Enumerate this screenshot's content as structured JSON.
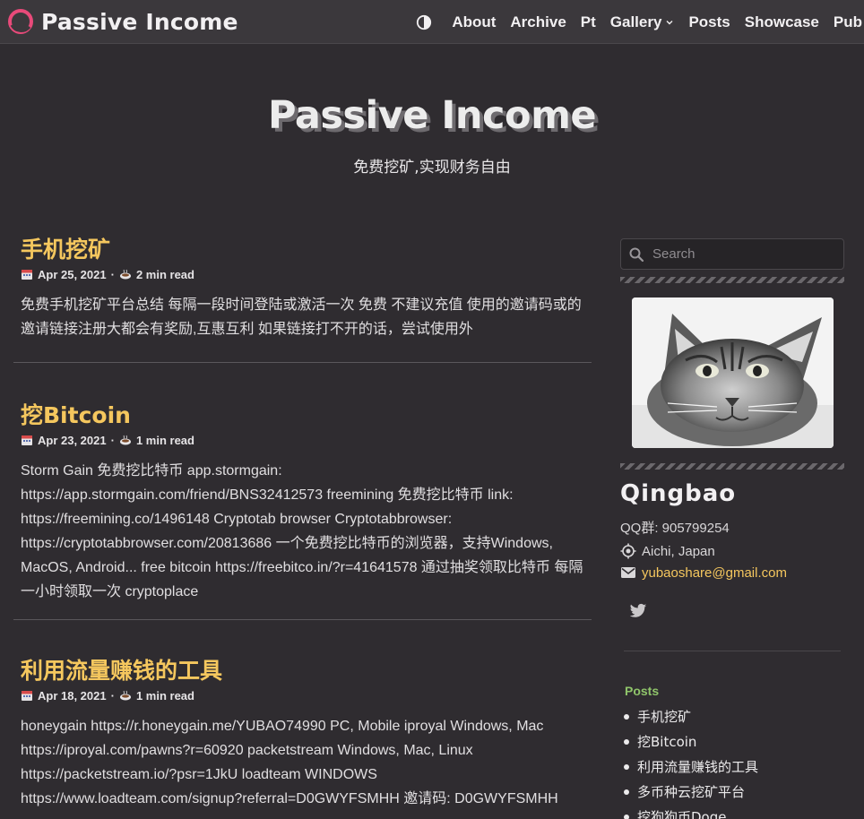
{
  "header": {
    "site_title": "Passive Income",
    "logo_icon": "ring-logo-icon",
    "theme_toggle_icon": "half-circle-contrast-icon",
    "nav": [
      {
        "label": "About"
      },
      {
        "label": "Archive"
      },
      {
        "label": "Pt"
      },
      {
        "label": "Gallery",
        "has_dropdown": true
      },
      {
        "label": "Posts"
      },
      {
        "label": "Showcase"
      },
      {
        "label": "Pub"
      }
    ]
  },
  "hero": {
    "title": "Passive Income",
    "subtitle": "免费挖矿,实现财务自由"
  },
  "posts": [
    {
      "title": "手机挖矿",
      "date": "Apr 25, 2021",
      "read_time": "2 min read",
      "excerpt": "免费手机挖矿平台总结 每隔一段时间登陆或激活一次 免费 不建议充值 使用的邀请码或的邀请链接注册大都会有奖励,互惠互利 如果链接打不开的话，尝试使用外"
    },
    {
      "title": "挖Bitcoin",
      "date": "Apr 23, 2021",
      "read_time": "1 min read",
      "excerpt": "Storm Gain 免费挖比特币 app.stormgain: https://app.stormgain.com/friend/BNS32412573 freemining 免费挖比特币 link: https://freemining.co/1496148 Cryptotab browser Cryptotabbrowser: https://cryptotabbrowser.com/20813686 一个免费挖比特币的浏览器，支持Windows, MacOS, Android... free bitcoin https://freebitco.in/?r=41641578 通过抽奖领取比特币 每隔一小时领取一次 cryptoplace"
    },
    {
      "title": "利用流量赚钱的工具",
      "date": "Apr 18, 2021",
      "read_time": "1 min read",
      "excerpt": "honeygain https://r.honeygain.me/YUBAO74990 PC, Mobile iproyal Windows, Mac https://iproyal.com/pawns?r=60920 packetstream Windows, Mac, Linux https://packetstream.io/?psr=1JkU loadteam WINDOWS https://www.loadteam.com/signup?referral=D0GWYFSMHH 邀请码: D0GWYFSMHH"
    }
  ],
  "meta_sep": "·",
  "sidebar": {
    "search_placeholder": "Search",
    "author_name": "Qingbao",
    "qq": "QQ群: 905799254",
    "location": "Aichi, Japan",
    "email": "yubaoshare@gmail.com",
    "social_icon": "twitter-icon",
    "posts_heading": "Posts",
    "posts_list": [
      "手机挖矿",
      "挖Bitcoin",
      "利用流量赚钱的工具",
      "多币种云挖矿平台",
      "挖狗狗币Doge"
    ]
  },
  "colors": {
    "background": "#2f2c30",
    "navbar": "#3b383c",
    "accent_yellow": "#f5c75e",
    "sidebar_heading_green": "#8fc46a",
    "logo_pink": "#e84a7a"
  }
}
